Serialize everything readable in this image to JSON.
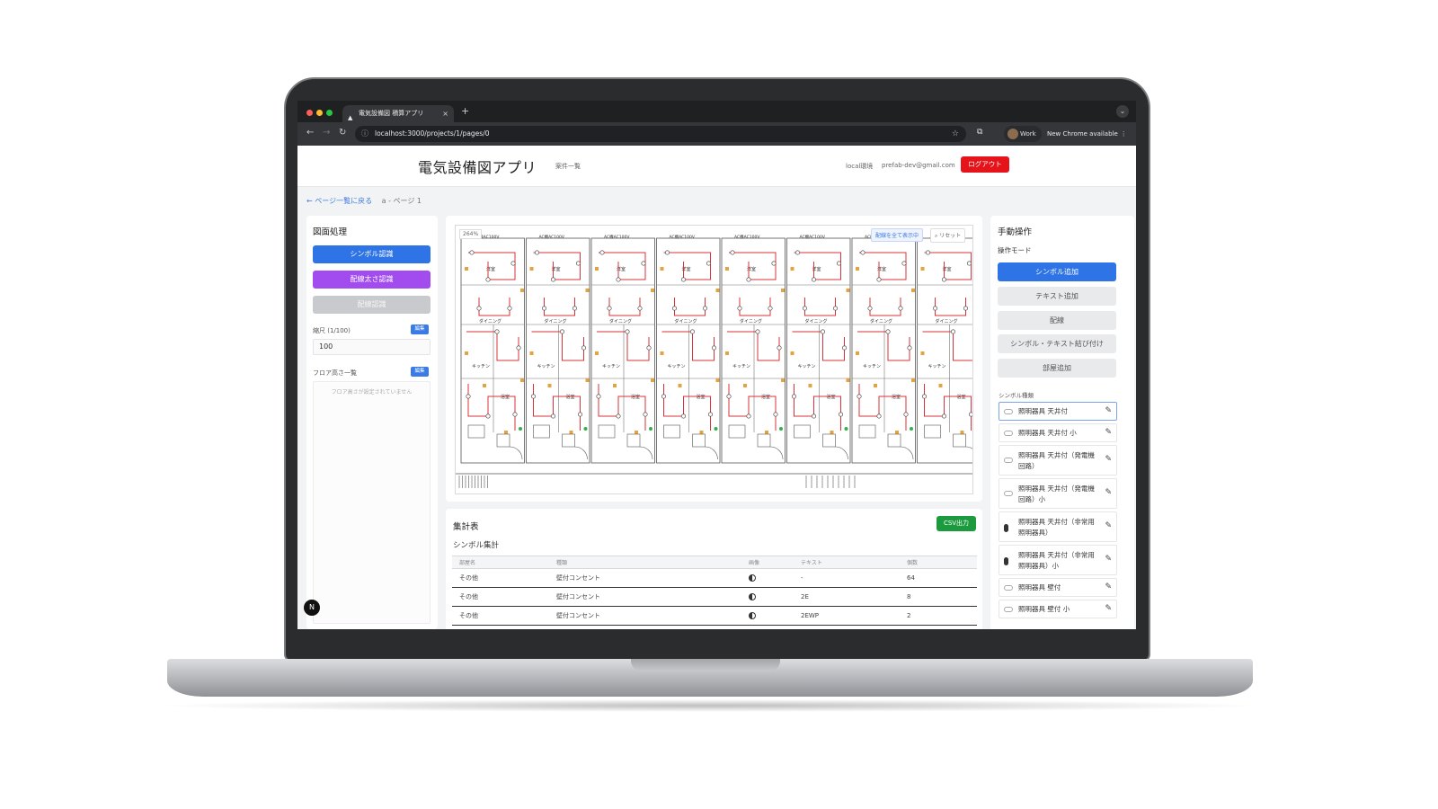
{
  "browser": {
    "tab_title": "電気設備図 積算アプリ",
    "tab_close": "×",
    "new_tab": "+",
    "url": "localhost:3000/projects/1/pages/0",
    "profile": "Work",
    "update_notice": "New Chrome available"
  },
  "header": {
    "app_title": "電気設備図アプリ",
    "nav_projects": "案件一覧",
    "user_label": "local環境",
    "email": "prefab-dev@gmail.com",
    "logout": "ログアウト"
  },
  "breadcrumb": {
    "back": "← ページ一覧に戻る",
    "current": "a - ページ 1"
  },
  "left_panel": {
    "title": "図面処理",
    "symbol_recognition": "シンボル認識",
    "wire_thickness_recognition": "配線太さ認識",
    "wire_recognition": "配線認識",
    "scale_label": "縮尺 (1/100)",
    "scale_edit": "編集",
    "scale_value": "100",
    "floor_height_label": "フロア高さ一覧",
    "floor_edit": "編集",
    "floor_empty": "フロア高さが設定されていません",
    "badge": "N"
  },
  "drawing": {
    "zoom": "264%",
    "show_all_wires": "配線を全て表示中",
    "reset": "リセット",
    "column_labels": [
      "AC機AC100V",
      "AC機AC100V",
      "AC機AC100V",
      "AC機AC100V",
      "AC機AC100V",
      "AC機AC100V",
      "AC機AC100V",
      "AC機AC100V"
    ],
    "room_upper": "洋室",
    "room_dining": "ダイニング",
    "room_kitchen": "キッチン",
    "room_bath": "浴室"
  },
  "summary": {
    "title": "集計表",
    "csv_button": "CSV出力",
    "subtitle": "シンボル集計",
    "columns": [
      "部屋名",
      "種類",
      "画像",
      "テキスト",
      "個数"
    ],
    "rows": [
      {
        "room": "その他",
        "type": "壁付コンセント",
        "text": "-",
        "count": "64"
      },
      {
        "room": "その他",
        "type": "壁付コンセント",
        "text": "2E",
        "count": "8"
      },
      {
        "room": "その他",
        "type": "壁付コンセント",
        "text": "2EWP",
        "count": "2"
      }
    ]
  },
  "right_panel": {
    "title": "手動操作",
    "mode_label": "操作モード",
    "modes": [
      "シンボル追加",
      "テキスト追加",
      "配線",
      "シンボル・テキスト結び付け",
      "部屋追加"
    ],
    "symbol_types_label": "シンボル種類",
    "symbols": [
      "照明器具 天井付",
      "照明器具 天井付 小",
      "照明器具 天井付（発電機回路）",
      "照明器具 天井付（発電機回路）小",
      "照明器具 天井付（非常用照明器具）",
      "照明器具 天井付（非常用照明器具）小",
      "照明器具 壁付",
      "照明器具 壁付 小"
    ]
  },
  "colors": {
    "primary": "#2e74e6",
    "purple": "#a24cf0",
    "danger": "#e5141b",
    "success": "#1c9a3e",
    "wire": "#d8333a"
  }
}
